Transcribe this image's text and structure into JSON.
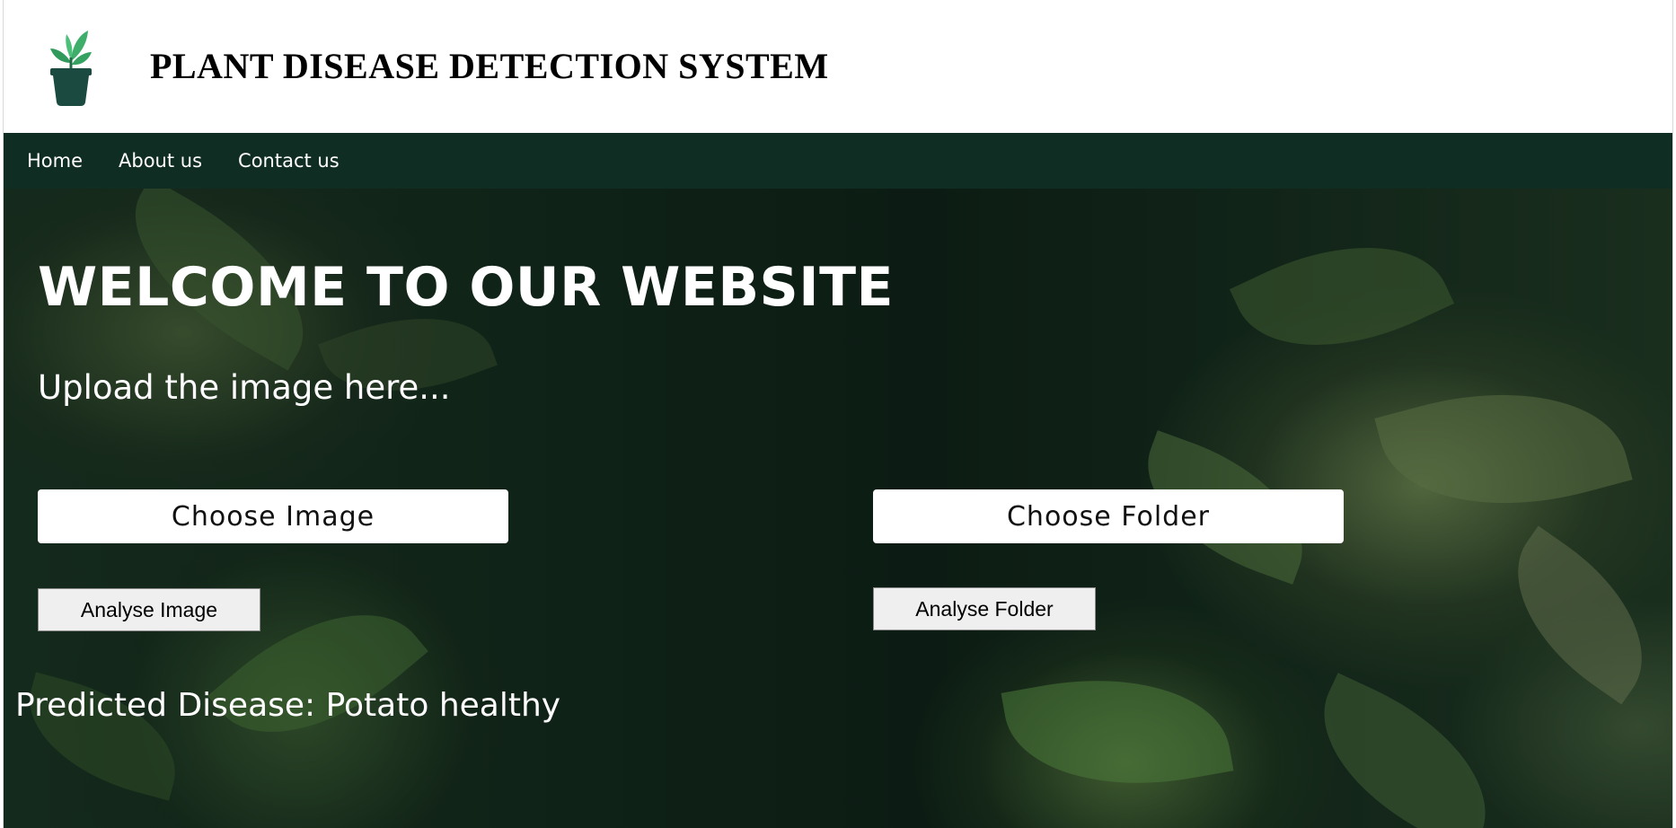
{
  "header": {
    "title": "PLANT DISEASE DETECTION SYSTEM",
    "logo_icon": "potted-plant-icon"
  },
  "nav": {
    "items": [
      {
        "label": "Home"
      },
      {
        "label": "About us"
      },
      {
        "label": "Contact us"
      }
    ]
  },
  "hero": {
    "heading": "WELCOME TO OUR WEBSITE",
    "subheading": "Upload the image here...",
    "choose_image_label": "Choose Image",
    "choose_folder_label": "Choose Folder",
    "analyse_image_label": "Analyse Image",
    "analyse_folder_label": "Analyse Folder",
    "prediction": "Predicted Disease: Potato healthy"
  },
  "colors": {
    "nav_bg": "#102d24",
    "logo_pot": "#1b4a40",
    "logo_leaf": "#3fae6a"
  }
}
